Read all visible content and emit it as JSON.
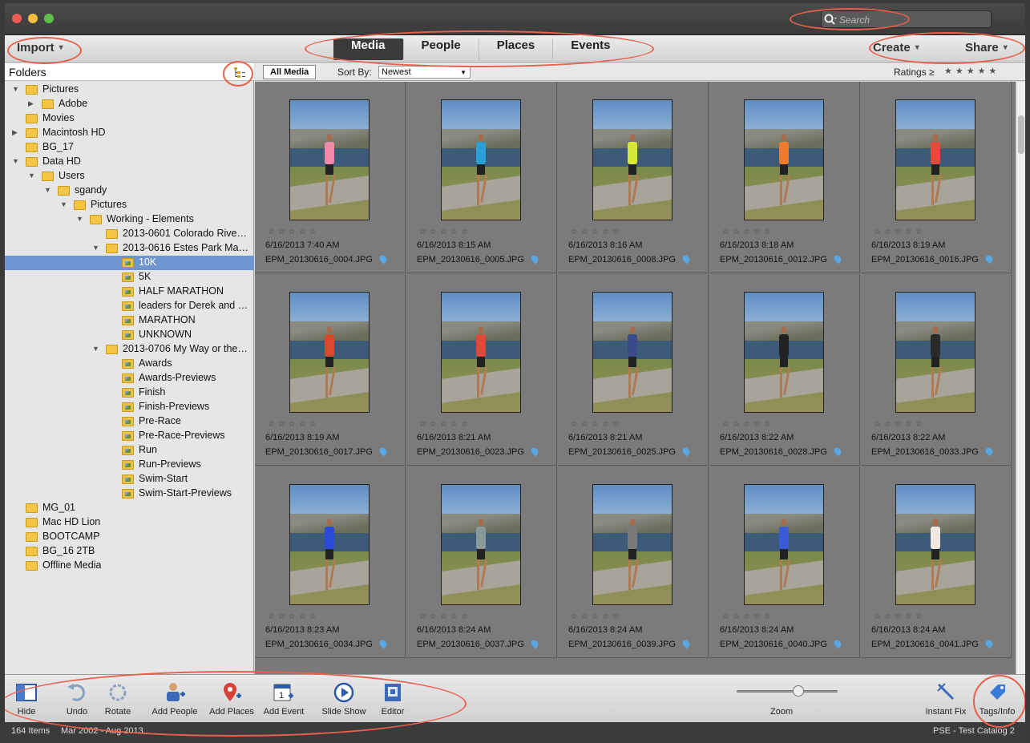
{
  "search": {
    "placeholder": "Search"
  },
  "toolbar": {
    "import": "Import",
    "create": "Create",
    "share": "Share"
  },
  "tabs": [
    "Media",
    "People",
    "Places",
    "Events"
  ],
  "folders": {
    "title": "Folders",
    "items": [
      {
        "label": "Pictures",
        "expanded": true,
        "level": 0
      },
      {
        "label": "Adobe",
        "expanded": false,
        "level": 1
      },
      {
        "label": "Movies",
        "level": 0
      },
      {
        "label": "Macintosh HD",
        "expanded": false,
        "level": 0
      },
      {
        "label": "BG_17",
        "level": 0
      },
      {
        "label": "Data HD",
        "expanded": true,
        "level": 0
      },
      {
        "label": "Users",
        "expanded": true,
        "level": 1
      },
      {
        "label": "sgandy",
        "expanded": true,
        "level": 2
      },
      {
        "label": "Pictures",
        "expanded": true,
        "level": 3
      },
      {
        "label": "Working - Elements",
        "expanded": true,
        "level": 4
      },
      {
        "label": "2013-0601 Colorado Rive…",
        "level": 5
      },
      {
        "label": "2013-0616 Estes Park Mar…",
        "expanded": true,
        "level": 5
      },
      {
        "label": "10K",
        "level": 6,
        "selected": true
      },
      {
        "label": "5K",
        "level": 6
      },
      {
        "label": "HALF MARATHON",
        "level": 6
      },
      {
        "label": "leaders for Derek and …",
        "level": 6
      },
      {
        "label": "MARATHON",
        "level": 6
      },
      {
        "label": "UNKNOWN",
        "level": 6
      },
      {
        "label": "2013-0706 My Way or the…",
        "expanded": true,
        "level": 5
      },
      {
        "label": "Awards",
        "level": 6
      },
      {
        "label": "Awards-Previews",
        "level": 6
      },
      {
        "label": "Finish",
        "level": 6
      },
      {
        "label": "Finish-Previews",
        "level": 6
      },
      {
        "label": "Pre-Race",
        "level": 6
      },
      {
        "label": "Pre-Race-Previews",
        "level": 6
      },
      {
        "label": "Run",
        "level": 6
      },
      {
        "label": "Run-Previews",
        "level": 6
      },
      {
        "label": "Swim-Start",
        "level": 6
      },
      {
        "label": "Swim-Start-Previews",
        "level": 6
      },
      {
        "label": "MG_01",
        "level": 0
      },
      {
        "label": "Mac HD Lion",
        "level": 0
      },
      {
        "label": "BOOTCAMP",
        "level": 0
      },
      {
        "label": "BG_16 2TB",
        "level": 0
      },
      {
        "label": "Offline Media",
        "level": 0
      }
    ]
  },
  "filter": {
    "all_media": "All Media",
    "sort_label": "Sort By:",
    "sort_value": "Newest",
    "ratings_label": "Ratings",
    "ratings_op": "≥"
  },
  "media": [
    {
      "date": "6/16/2013 7:40 AM",
      "file": "EPM_20130616_0004.JPG",
      "shirt": "#f08aa8"
    },
    {
      "date": "6/16/2013 8:15 AM",
      "file": "EPM_20130616_0005.JPG",
      "shirt": "#2a9fd8"
    },
    {
      "date": "6/16/2013 8:16 AM",
      "file": "EPM_20130616_0008.JPG",
      "shirt": "#d6e83a"
    },
    {
      "date": "6/16/2013 8:18 AM",
      "file": "EPM_20130616_0012.JPG",
      "shirt": "#f07a2a"
    },
    {
      "date": "6/16/2013 8:19 AM",
      "file": "EPM_20130616_0016.JPG",
      "shirt": "#e84a3a"
    },
    {
      "date": "6/16/2013 8:19 AM",
      "file": "EPM_20130616_0017.JPG",
      "shirt": "#d84a2a"
    },
    {
      "date": "6/16/2013 8:21 AM",
      "file": "EPM_20130616_0023.JPG",
      "shirt": "#e0483a"
    },
    {
      "date": "6/16/2013 8:21 AM",
      "file": "EPM_20130616_0025.JPG",
      "shirt": "#3a4a8a"
    },
    {
      "date": "6/16/2013 8:22 AM",
      "file": "EPM_20130616_0028.JPG",
      "shirt": "#222222"
    },
    {
      "date": "6/16/2013 8:22 AM",
      "file": "EPM_20130616_0033.JPG",
      "shirt": "#2a2a2a"
    },
    {
      "date": "6/16/2013 8:23 AM",
      "file": "EPM_20130616_0034.JPG",
      "shirt": "#2a4ad8"
    },
    {
      "date": "6/16/2013 8:24 AM",
      "file": "EPM_20130616_0037.JPG",
      "shirt": "#8a9a9a"
    },
    {
      "date": "6/16/2013 8:24 AM",
      "file": "EPM_20130616_0039.JPG",
      "shirt": "#7a7a7a"
    },
    {
      "date": "6/16/2013 8:24 AM",
      "file": "EPM_20130616_0040.JPG",
      "shirt": "#3a5ad8"
    },
    {
      "date": "6/16/2013 8:24 AM",
      "file": "EPM_20130616_0041.JPG",
      "shirt": "#f0e8e0"
    }
  ],
  "bottom": {
    "hide": "Hide",
    "undo": "Undo",
    "rotate": "Rotate",
    "add_people": "Add People",
    "add_places": "Add Places",
    "add_event": "Add Event",
    "slide_show": "Slide Show",
    "editor": "Editor",
    "zoom": "Zoom",
    "instant_fix": "Instant Fix",
    "tags_info": "Tags/Info",
    "zoom_level": 0.6
  },
  "status": {
    "items": "164 Items",
    "range": "Mar 2002 - Aug 2013",
    "catalog": "PSE - Test Catalog 2"
  },
  "colors": {
    "annotation": "#e8604c",
    "selection": "#6f94d2"
  }
}
